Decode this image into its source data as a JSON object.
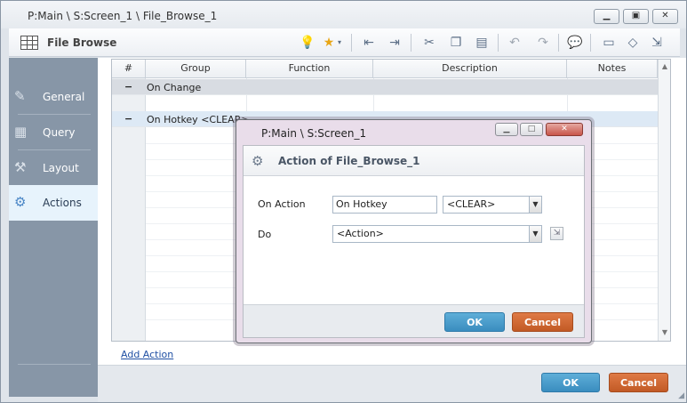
{
  "window": {
    "title": "P:Main \\ S:Screen_1 \\ File_Browse_1",
    "controls": {
      "minimize": "▁",
      "maximize": "▣",
      "close": "✕"
    }
  },
  "toolbar": {
    "name": "File Browse",
    "icons": [
      "grid-icon",
      "lightbulb-icon",
      "star-icon",
      "outdent-icon",
      "indent-icon",
      "cut-icon",
      "copy-icon",
      "paste-icon",
      "undo-icon",
      "redo-icon",
      "comment-icon",
      "note-icon",
      "diamond-icon",
      "expand-icon"
    ]
  },
  "sidebar": {
    "items": [
      {
        "label": "General",
        "icon": "general-icon",
        "active": false
      },
      {
        "label": "Query",
        "icon": "query-icon",
        "active": false
      },
      {
        "label": "Layout",
        "icon": "layout-icon",
        "active": false
      },
      {
        "label": "Actions",
        "icon": "actions-icon",
        "active": true
      }
    ]
  },
  "grid": {
    "columns": [
      "#",
      "Group",
      "Function",
      "Description",
      "Notes"
    ],
    "rows": [
      {
        "toggle": "−",
        "text": "On Change"
      },
      {
        "toggle": "−",
        "text": "On Hotkey <CLEAR>"
      }
    ]
  },
  "add_action_link": "Add Action",
  "footer": {
    "ok": "OK",
    "cancel": "Cancel"
  },
  "dialog": {
    "title": "P:Main \\ S:Screen_1",
    "heading": "Action of File_Browse_1",
    "on_action_label": "On Action",
    "on_action_value": "On Hotkey",
    "hotkey_value": "<CLEAR>",
    "do_label": "Do",
    "do_value": "<Action>",
    "ok": "OK",
    "cancel": "Cancel",
    "controls": {
      "minimize": "▁",
      "maximize": "□",
      "close": "✕"
    }
  },
  "colors": {
    "accent_ok": "#3a8dbf",
    "accent_cancel": "#c25a25",
    "sidebar": "#8796a7",
    "link": "#1f4fa3"
  }
}
